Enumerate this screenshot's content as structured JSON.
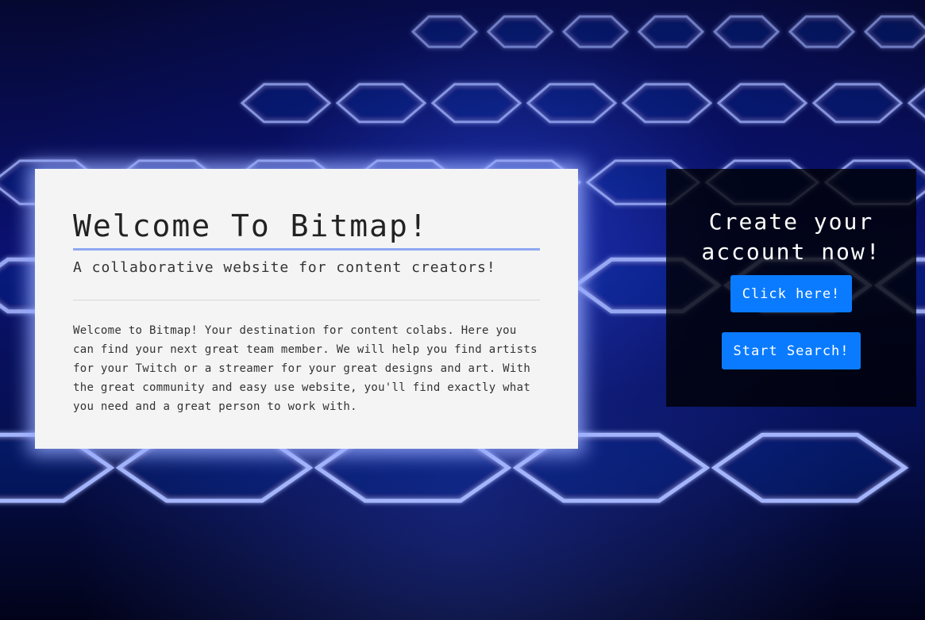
{
  "welcome": {
    "title": "Welcome To Bitmap!",
    "subtitle": "A collaborative website for content creators!",
    "body": "Welcome to Bitmap! Your destination for content colabs. Here you can find your next great team member. We will help you find artists for your Twitch or a streamer for your great designs and art. With the great community and easy use website, you'll find exactly what you need and a great person to work with."
  },
  "cta": {
    "heading": "Create your account now!",
    "click_label": "Click here!",
    "search_label": "Start Search!"
  },
  "colors": {
    "card_background": "#f4f4f4",
    "title_underline": "#8fa8f0",
    "button": "#0a7bff",
    "panel_background": "#000000",
    "hex_glow": "#a8b8ff"
  }
}
